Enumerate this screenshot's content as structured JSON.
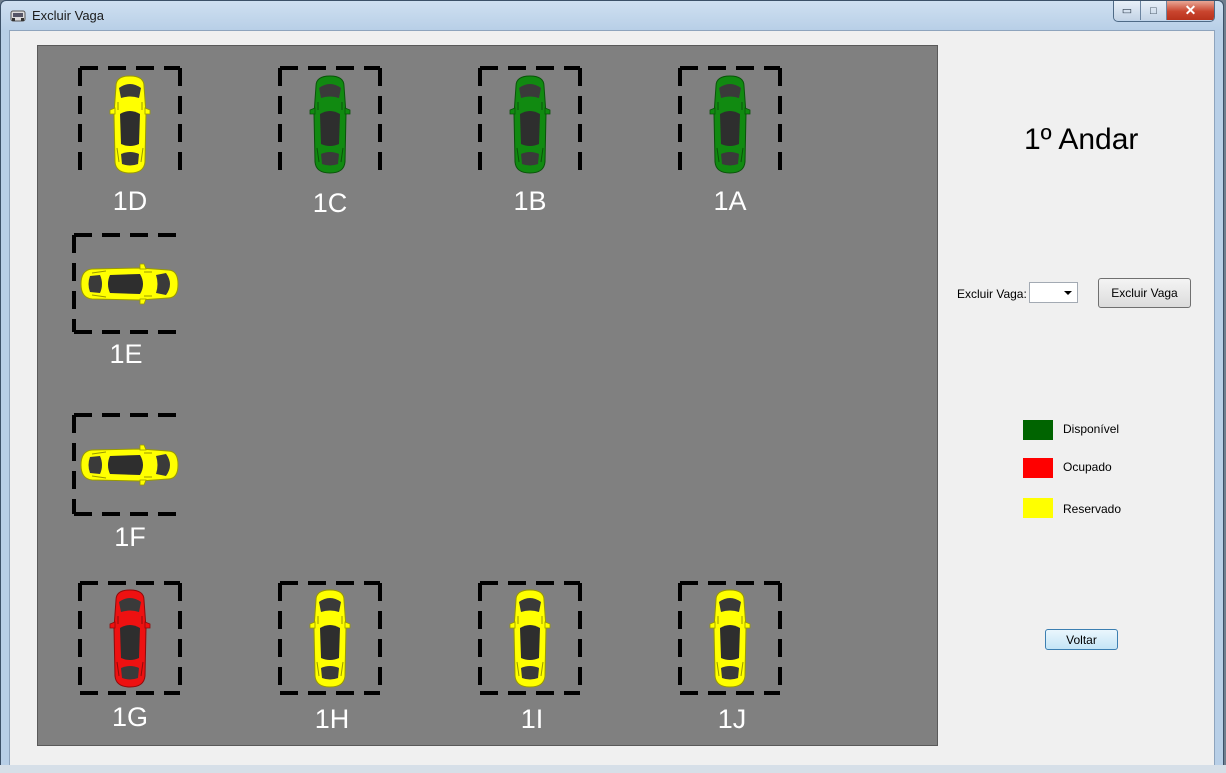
{
  "window": {
    "title": "Excluir Vaga",
    "controls": {
      "minimize": "▭",
      "maximize": "□",
      "close": "✕"
    }
  },
  "floor_title": "1º Andar",
  "form": {
    "excluir_label": "Excluir Vaga:",
    "combo_value": "",
    "excluir_button": "Excluir Vaga",
    "voltar_button": "Voltar"
  },
  "legend": [
    {
      "label": "Disponível",
      "color": "#006400"
    },
    {
      "label": "Ocupado",
      "color": "#ff0000"
    },
    {
      "label": "Reservado",
      "color": "#ffff00"
    }
  ],
  "spots": [
    {
      "id": "1D",
      "status": "Reservado",
      "color": "#ffff00",
      "orientation": "vertical"
    },
    {
      "id": "1C",
      "status": "Disponível",
      "color": "#118a11",
      "orientation": "vertical"
    },
    {
      "id": "1B",
      "status": "Disponível",
      "color": "#118a11",
      "orientation": "vertical"
    },
    {
      "id": "1A",
      "status": "Disponível",
      "color": "#118a11",
      "orientation": "vertical"
    },
    {
      "id": "1E",
      "status": "Reservado",
      "color": "#ffff00",
      "orientation": "horizontal"
    },
    {
      "id": "1F",
      "status": "Reservado",
      "color": "#ffff00",
      "orientation": "horizontal"
    },
    {
      "id": "1G",
      "status": "Ocupado",
      "color": "#ee1111",
      "orientation": "vertical"
    },
    {
      "id": "1H",
      "status": "Reservado",
      "color": "#ffff00",
      "orientation": "vertical"
    },
    {
      "id": "1I",
      "status": "Reservado",
      "color": "#ffff00",
      "orientation": "vertical"
    },
    {
      "id": "1J",
      "status": "Reservado",
      "color": "#ffff00",
      "orientation": "vertical"
    }
  ]
}
